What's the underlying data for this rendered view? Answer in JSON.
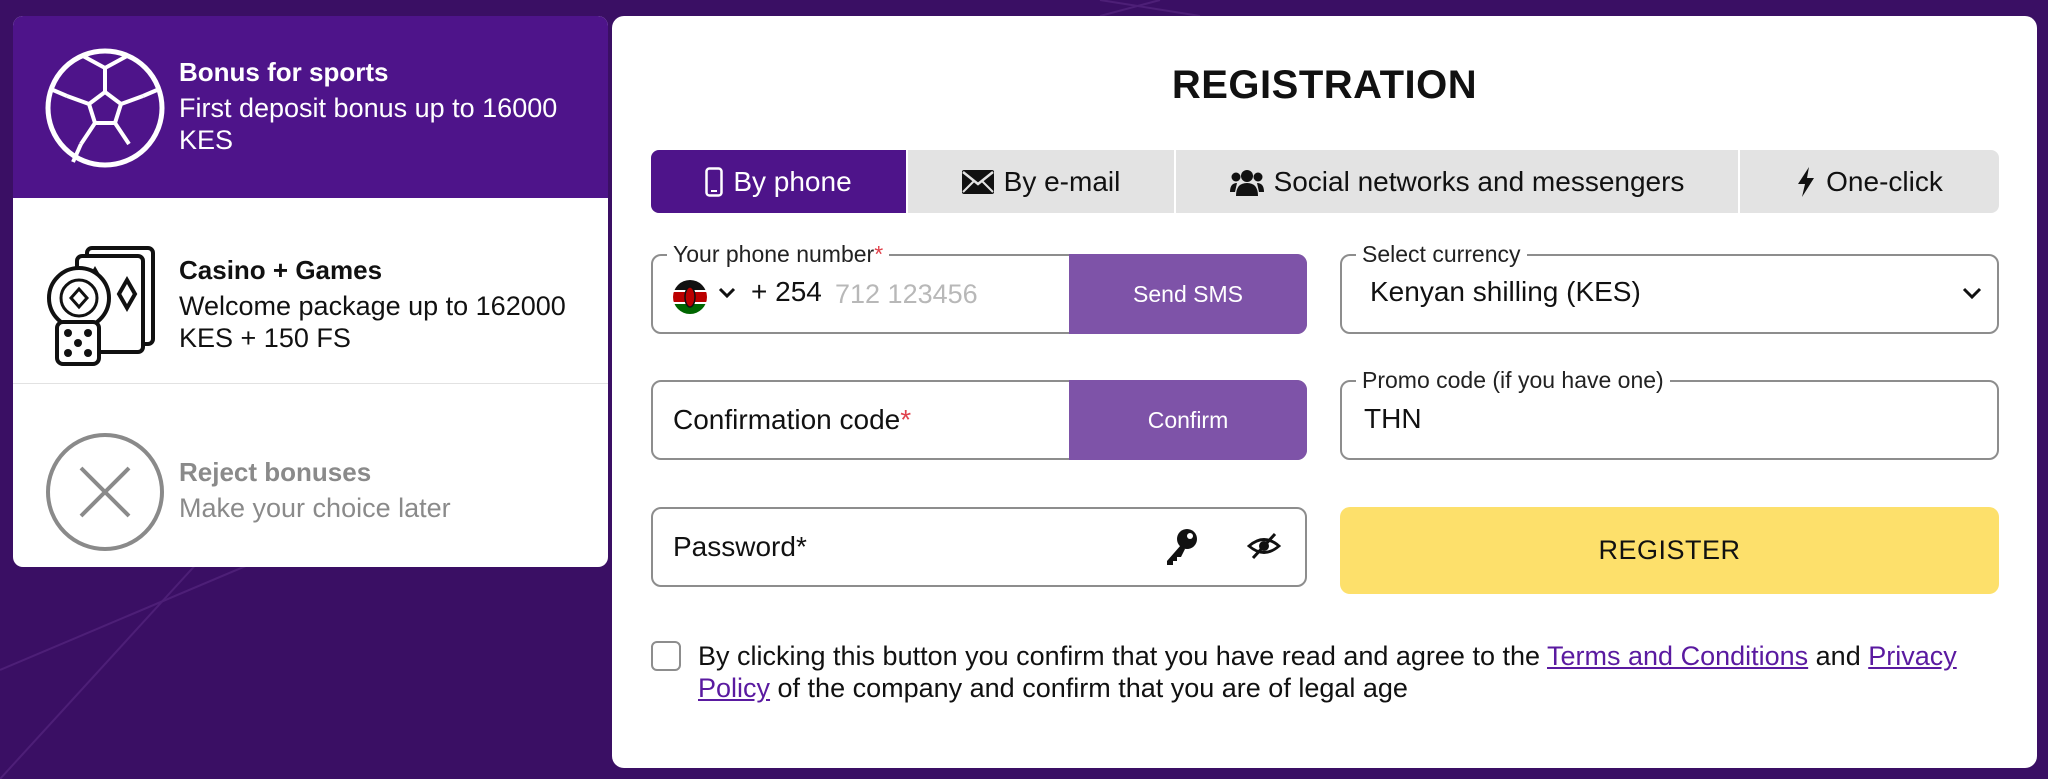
{
  "colors": {
    "background": "#3a0f64",
    "brand_purple": "#4e148a",
    "button_purple": "#7e53a8",
    "register_yellow": "#fde06b",
    "required_red": "#e0424c"
  },
  "bonuses": [
    {
      "title": "Bonus for sports",
      "description": "First deposit bonus up to 16000 KES",
      "icon": "soccer-ball-icon"
    },
    {
      "title": "Casino + Games",
      "description": "Welcome package up to 162000 KES + 150 FS",
      "icon": "casino-chips-cards-dice-icon"
    },
    {
      "title": "Reject bonuses",
      "description": "Make your choice later",
      "icon": "close-circle-icon"
    }
  ],
  "registration": {
    "title": "REGISTRATION",
    "tabs": [
      {
        "label": "By phone",
        "icon": "mobile-phone-icon",
        "active": true
      },
      {
        "label": "By e-mail",
        "icon": "envelope-icon",
        "active": false
      },
      {
        "label": "Social networks and messengers",
        "icon": "users-icon",
        "active": false
      },
      {
        "label": "One-click",
        "icon": "lightning-icon",
        "active": false
      }
    ],
    "phone": {
      "legend": "Your phone number",
      "required_mark": "*",
      "country_flag": "kenya-flag-icon",
      "dial_code": "+ 254",
      "placeholder": "712 123456",
      "button": "Send SMS"
    },
    "currency": {
      "legend": "Select currency",
      "value": "Kenyan shilling (KES)"
    },
    "confirmation": {
      "label": "Confirmation code",
      "required_mark": "*",
      "button": "Confirm"
    },
    "promo": {
      "legend": "Promo code (if you have one)",
      "value": "THN"
    },
    "password": {
      "label": "Password*"
    },
    "register_button": "REGISTER",
    "agreement": {
      "text_before": "By clicking this button you confirm that you have read and agree to the ",
      "terms_link": "Terms and Conditions",
      "text_and": " and ",
      "privacy_link": "Privacy Policy",
      "text_after": " of the company and confirm that you are of legal age"
    }
  }
}
